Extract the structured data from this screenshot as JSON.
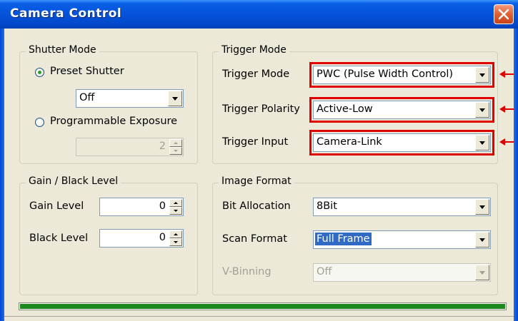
{
  "window": {
    "title": "Camera Control",
    "close_icon": "close-icon"
  },
  "shutter_mode": {
    "title": "Shutter Mode",
    "preset_label": "Preset Shutter",
    "preset_selected": true,
    "preset_value": "Off",
    "programmable_label": "Programmable Exposure",
    "programmable_selected": false,
    "exposure_value": "2"
  },
  "gain_black": {
    "title": "Gain / Black Level",
    "gain_label": "Gain Level",
    "gain_value": "0",
    "black_label": "Black Level",
    "black_value": "0"
  },
  "trigger_mode": {
    "title": "Trigger Mode",
    "mode_label": "Trigger Mode",
    "mode_value": "PWC (Pulse Width Control)",
    "polarity_label": "Trigger Polarity",
    "polarity_value": "Active-Low",
    "input_label": "Trigger Input",
    "input_value": "Camera-Link"
  },
  "image_format": {
    "title": "Image Format",
    "bit_label": "Bit Allocation",
    "bit_value": "8Bit",
    "scan_label": "Scan Format",
    "scan_value": "Full Frame",
    "vbin_label": "V-Binning",
    "vbin_value": "Off"
  },
  "status": {
    "progress_fraction": 1.0
  },
  "colors": {
    "highlight": "#e00000",
    "progress": "#1e8a1e",
    "selection": "#316ac5"
  }
}
